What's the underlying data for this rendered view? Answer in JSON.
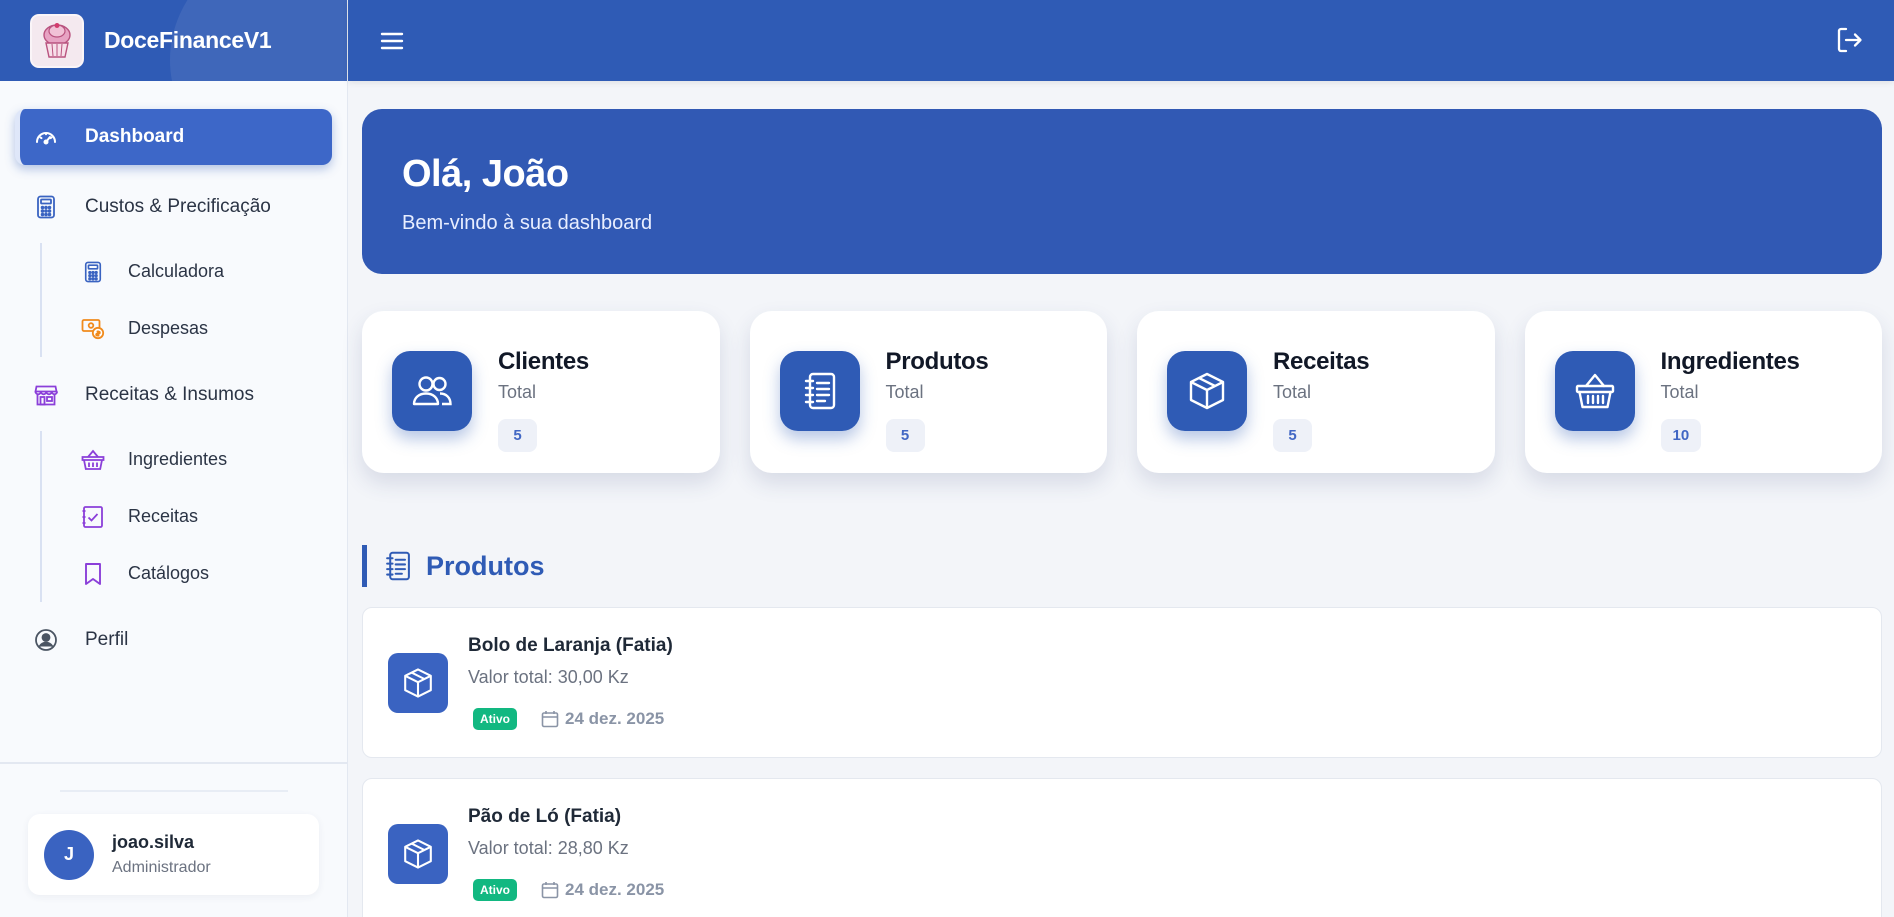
{
  "app": {
    "name": "DoceFinanceV1"
  },
  "sidebar": {
    "dashboard": "Dashboard",
    "custos": "Custos & Precificação",
    "calculadora": "Calculadora",
    "despesas": "Despesas",
    "receitas_insumos": "Receitas & Insumos",
    "ingredientes": "Ingredientes",
    "receitas": "Receitas",
    "catalogos": "Catálogos",
    "perfil": "Perfil"
  },
  "user": {
    "initial": "J",
    "name": "joao.silva",
    "role": "Administrador"
  },
  "hero": {
    "title": "Olá, João",
    "subtitle": "Bem-vindo à sua dashboard"
  },
  "stats": [
    {
      "title": "Clientes",
      "label": "Total",
      "value": "5",
      "icon": "users-icon"
    },
    {
      "title": "Produtos",
      "label": "Total",
      "value": "5",
      "icon": "notebook-icon"
    },
    {
      "title": "Receitas",
      "label": "Total",
      "value": "5",
      "icon": "box-icon"
    },
    {
      "title": "Ingredientes",
      "label": "Total",
      "value": "10",
      "icon": "basket-icon"
    }
  ],
  "products_section": {
    "title": "Produtos"
  },
  "products": [
    {
      "name": "Bolo de Laranja (Fatia)",
      "value": "Valor total: 30,00 Kz",
      "status": "Ativo",
      "date": "24 dez. 2025"
    },
    {
      "name": "Pão de Ló (Fatia)",
      "value": "Valor total: 28,80 Kz",
      "status": "Ativo",
      "date": "24 dez. 2025"
    }
  ],
  "colors": {
    "primary": "#2f5bb5",
    "status_active": "#12b881"
  }
}
